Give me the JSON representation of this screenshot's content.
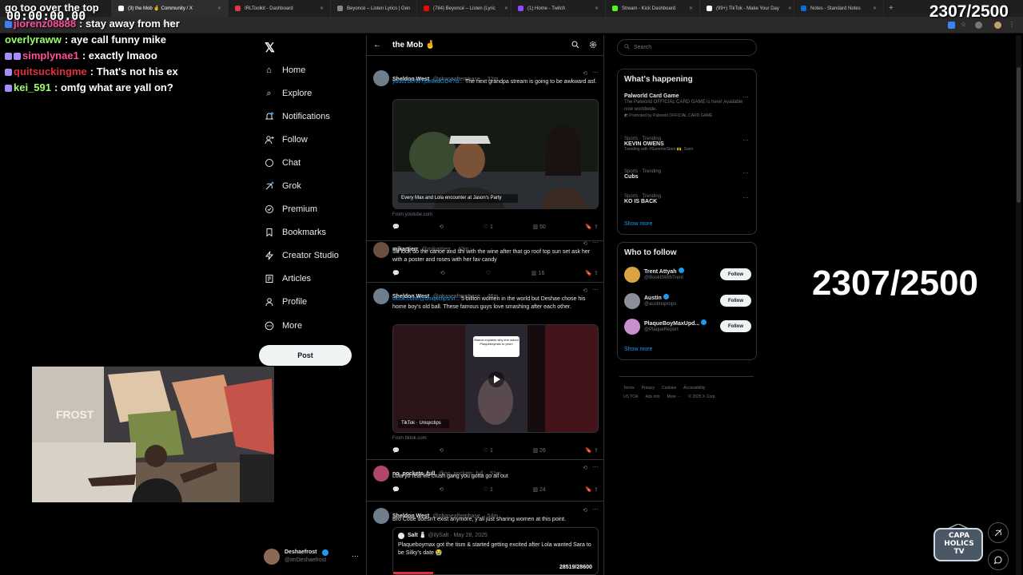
{
  "browser": {
    "tabs": [
      {
        "label": "",
        "color": "#3b3b3b"
      },
      {
        "label": "(3) the Mob 🤞 Community / X",
        "color": "#ffffff",
        "active": true
      },
      {
        "label": "IRLToolkit - Dashboard",
        "color": "#e2344b"
      },
      {
        "label": "Beyoncé – Listen Lyrics | Gen",
        "color": "#888888"
      },
      {
        "label": "(784) Beyoncé – Listen (Lyric",
        "color": "#ff0000"
      },
      {
        "label": "(1) Home - Twitch",
        "color": "#9146ff"
      },
      {
        "label": "Stream - Kick Dashboard",
        "color": "#53fc18"
      },
      {
        "label": "(99+) TikTok - Make Your Day",
        "color": "#ffffff"
      },
      {
        "label": "Notes - Standard Notes",
        "color": "#086dd6"
      }
    ],
    "new_tab": "+",
    "address_fragment": "8926"
  },
  "overlay": {
    "goal_counter": "2307/2500",
    "timer": "00:00:00.00"
  },
  "chat": [
    {
      "user": "",
      "user_color": "#ffffff",
      "text": "go too over the top",
      "badge": ""
    },
    {
      "user": "jlorenz08888",
      "user_color": "#ff4f9a",
      "text": "stay away from her",
      "badge": "#3b82f6"
    },
    {
      "user": "overlyraww",
      "user_color": "#9aff6b",
      "text": "aye call funny mike",
      "badge": ""
    },
    {
      "user": "simplynae1",
      "user_color": "#ff4f9a",
      "text": "exactly lmaoo",
      "badge": "#a78bfa"
    },
    {
      "user": "quitsuckingme",
      "user_color": "#e0303c",
      "text": "That's not his ex",
      "badge": "#a78bfa"
    },
    {
      "user": "kei_591",
      "user_color": "#9aff6b",
      "text": "omfg what are yall on?",
      "badge": "#a78bfa"
    }
  ],
  "nav": {
    "logo": "𝕏",
    "items": [
      {
        "label": "Home",
        "icon": "⌂"
      },
      {
        "label": "Explore",
        "icon": "⌕"
      },
      {
        "label": "Notifications",
        "icon": "🔔"
      },
      {
        "label": "Follow",
        "icon": "👤"
      },
      {
        "label": "Chat",
        "icon": "💬"
      },
      {
        "label": "Grok",
        "icon": "◪"
      },
      {
        "label": "Premium",
        "icon": "✓"
      },
      {
        "label": "Bookmarks",
        "icon": "🔖"
      },
      {
        "label": "Creator Studio",
        "icon": "⚡"
      },
      {
        "label": "Articles",
        "icon": "▤"
      },
      {
        "label": "Profile",
        "icon": "👤"
      },
      {
        "label": "More",
        "icon": "⋯"
      }
    ],
    "post_label": "Post",
    "account": {
      "name": "Deshaefrost",
      "handle": "@imDeshaefrost",
      "more": "⋯"
    }
  },
  "feed": {
    "back": "←",
    "title": "the Mob 🤞",
    "tweets": [
      {
        "name": "Sheldon West",
        "handle": "@phaseafterphase",
        "time": "· 32m",
        "link": "youtu.be/W7joe8xdGD4?si...",
        "text": "The next grandpa stream is going to be awkward asf.",
        "media_caption": "Every Max and Lola encounter at Jason's Party",
        "from": "From youtube.com",
        "counts": {
          "reply": "",
          "repost": "",
          "like": "1",
          "views": "50"
        },
        "avatar": "#6f7e8c"
      },
      {
        "name": "mjkartierr",
        "handle": "@mjkartierr",
        "time": "· 42m",
        "link": "",
        "text": "So look do the canoe and shi with the wine after that go roof top sun set ask her with a poster and roses with her fav candy",
        "counts": {
          "reply": "",
          "repost": "",
          "like": "",
          "views": "16"
        },
        "avatar": "#6b4f3f"
      },
      {
        "name": "Sheldon West",
        "handle": "@phaseafterphase",
        "time": "· 46m",
        "link": "tiktok.com/@uniqxclips/vi...",
        "text": "5 billion women in the world but Deshae chose his home boy's old ball. These famous guys love smashing after each other.",
        "media_caption": "TikTok · Uniqxclips",
        "overlay_text": "Bianca explains why she asked Plaqueboymax to prom",
        "from": "From tiktok.com",
        "counts": {
          "reply": "",
          "repost": "",
          "like": "1",
          "views": "26"
        },
        "avatar": "#6f7e8c"
      },
      {
        "name": "no_pockets_full",
        "handle": "@no_pockets_full",
        "time": "· 51m",
        "link": "",
        "text": "Lola yo real life crush gang you gotta go all out",
        "counts": {
          "reply": "",
          "repost": "",
          "like": "1",
          "views": "24"
        },
        "avatar": "#b0476b"
      },
      {
        "name": "Sheldon West",
        "handle": "@phaseafterphase",
        "time": "· 54m",
        "link": "",
        "text": "Bro Code doesn't exist anymore, y'all just sharing women at this point.",
        "quote": {
          "name": "Salt 🧂",
          "handle": "@ilySalt",
          "time": "· May 28, 2025",
          "text": "Plaqueboymax got the tism & started getting excited after Lola wanted Sara to be Silky's date 😭"
        },
        "avatar": "#6f7e8c"
      }
    ],
    "donation_counter": "28519/28600"
  },
  "sidebar": {
    "search_placeholder": "Search",
    "happening_title": "What's happening",
    "trends": [
      {
        "meta": "",
        "name": "Palworld Card Game",
        "desc": "The Palworld OFFICIAL CARD GAME is here! Available now worldwide.",
        "promo": "Promoted by Palworld OFFICIAL CARD GAME"
      },
      {
        "meta": "Sports · Trending",
        "name": "KEVIN OWENS",
        "desc": "Trending with #SummerSlam 🙌, Sami"
      },
      {
        "meta": "Sports · Trending",
        "name": "Cubs",
        "desc": ""
      },
      {
        "meta": "Sports · Trending",
        "name": "KO IS BACK",
        "desc": ""
      }
    ],
    "show_more": "Show more",
    "who_title": "Who to follow",
    "who": [
      {
        "name": "Trent Attyah",
        "handle": "@BookItWithTrent",
        "button": "Follow",
        "avatar": "#d9a441"
      },
      {
        "name": "Austin",
        "handle": "@austinsprops",
        "button": "Follow",
        "avatar": "#8a8f99"
      },
      {
        "name": "PlaqueBoyMaxUpd...",
        "handle": "@PlaqueReport",
        "button": "Follow",
        "avatar": "#c98fd0"
      }
    ],
    "who_show_more": "Show more",
    "footer1": [
      "Terms",
      "Privacy",
      "Cookies",
      "Accessibility"
    ],
    "footer2": [
      "US TOA",
      "Ads info",
      "More ···",
      "© 2025 X Corp."
    ]
  },
  "brand": {
    "capa_line1": "CAPA",
    "capa_line2": "HOLICS",
    "capa_line3": "TV"
  }
}
